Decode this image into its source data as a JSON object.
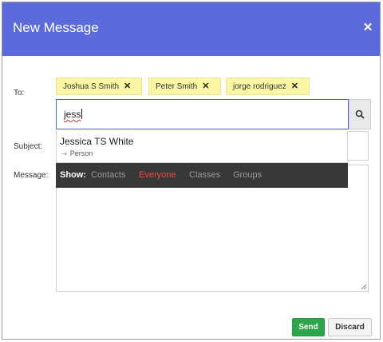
{
  "header": {
    "title": "New Message",
    "close_icon": "close-icon"
  },
  "labels": {
    "to": "To:",
    "subject": "Subject:",
    "message": "Message:"
  },
  "recipients": [
    {
      "name": "Joshua S Smith"
    },
    {
      "name": "Peter Smith"
    },
    {
      "name": "jorge rodriguez"
    }
  ],
  "to_input": {
    "value": "jess"
  },
  "suggestion": {
    "name": "Jessica TS White",
    "type": "Person"
  },
  "show_filter": {
    "label": "Show:",
    "options": [
      "Contacts",
      "Everyone",
      "Classes",
      "Groups"
    ],
    "selected": "Everyone"
  },
  "buttons": {
    "send": "Send",
    "discard": "Discard"
  },
  "colors": {
    "header": "#5b6bdb",
    "chip": "#fbf5a6",
    "send": "#2fa54b",
    "active_filter": "#e84c3d"
  }
}
